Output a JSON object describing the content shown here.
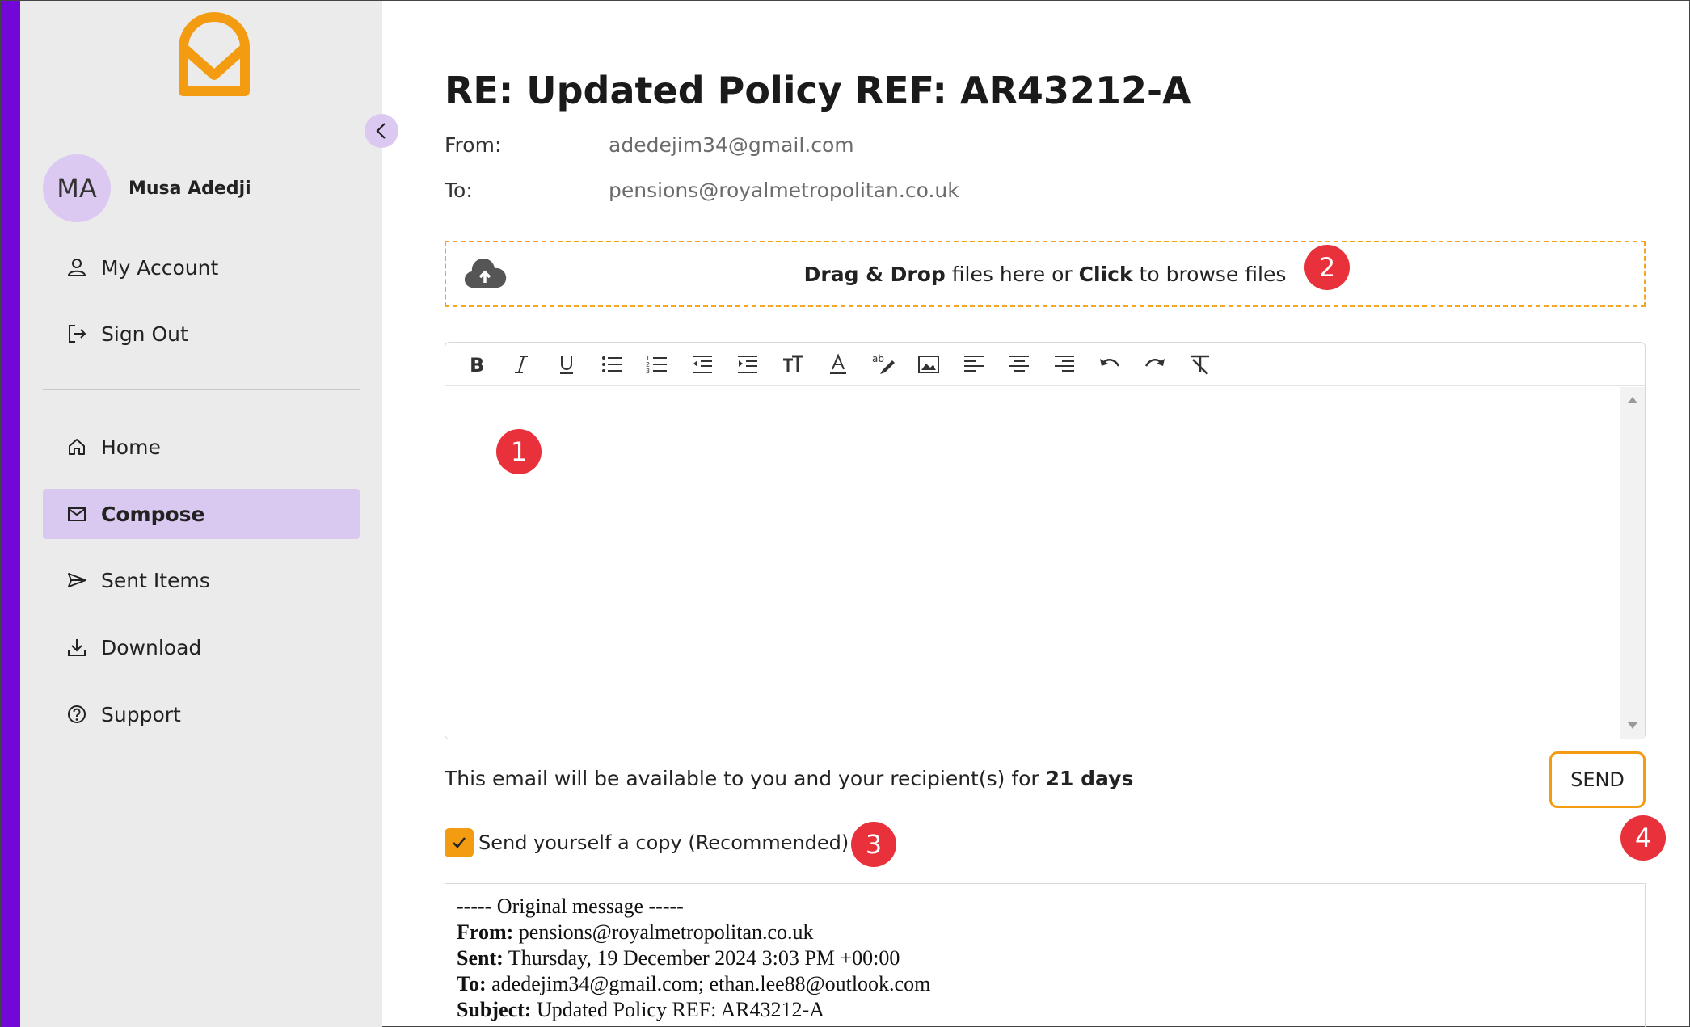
{
  "user": {
    "initials": "MA",
    "name": "Musa Adedji"
  },
  "account_menu": [
    {
      "label": "My Account",
      "icon": "user-icon"
    },
    {
      "label": "Sign Out",
      "icon": "sign-out-icon"
    }
  ],
  "nav": [
    {
      "label": "Home",
      "icon": "home-icon"
    },
    {
      "label": "Compose",
      "icon": "envelope-icon",
      "active": true
    },
    {
      "label": "Sent Items",
      "icon": "send-icon"
    },
    {
      "label": "Download",
      "icon": "download-icon"
    },
    {
      "label": "Support",
      "icon": "help-icon"
    }
  ],
  "email": {
    "subject": "RE: Updated Policy REF: AR43212-A",
    "from_label": "From:",
    "from_value": "adedejim34@gmail.com",
    "to_label": "To:",
    "to_value": "pensions@royalmetropolitan.co.uk"
  },
  "dropzone": {
    "bold1": "Drag & Drop",
    "text1": " files here or ",
    "bold2": "Click",
    "text2": " to browse files"
  },
  "toolbar": [
    "bold-icon",
    "italic-icon",
    "underline-icon",
    "bullet-list-icon",
    "numbered-list-icon",
    "outdent-icon",
    "indent-icon",
    "font-size-icon",
    "font-color-icon",
    "highlight-icon",
    "image-icon",
    "align-left-icon",
    "align-center-icon",
    "align-right-icon",
    "undo-icon",
    "redo-icon",
    "clear-format-icon"
  ],
  "availability": {
    "text": "This email will be available to you and your recipient(s) for ",
    "days": "21 days"
  },
  "send_label": "SEND",
  "copy": {
    "label": "Send yourself a copy (Recommended)",
    "checked": true
  },
  "original": {
    "header": "----- Original message -----",
    "from_label": "From:",
    "from_value": " pensions@royalmetropolitan.co.uk",
    "sent_label": "Sent:",
    "sent_value": " Thursday, 19 December 2024 3:03 PM +00:00",
    "to_label": "To:",
    "to_value": " adedejim34@gmail.com; ethan.lee88@outlook.com",
    "subject_label": "Subject:",
    "subject_value": " Updated Policy REF: AR43212-A"
  },
  "badges": [
    "1",
    "2",
    "3",
    "4"
  ],
  "colors": {
    "brand_purple": "#7108d8",
    "accent_orange": "#f39c12",
    "active_nav": "#d9c8ef",
    "badge_red": "#e8313a"
  }
}
